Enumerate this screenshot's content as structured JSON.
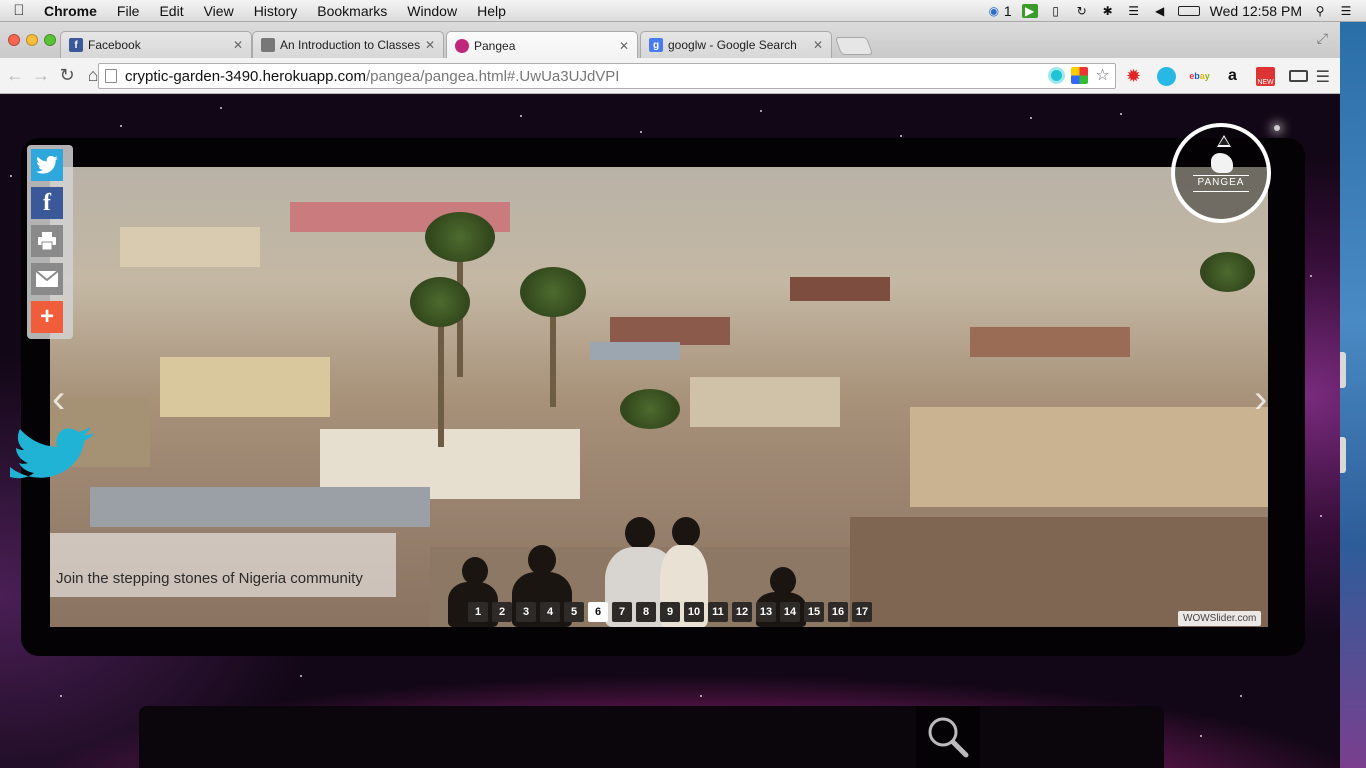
{
  "menubar": {
    "app_name": "Chrome",
    "items": [
      "File",
      "Edit",
      "View",
      "History",
      "Bookmarks",
      "Window",
      "Help"
    ],
    "status_badge": "1",
    "clock": "Wed 12:58 PM"
  },
  "tabs": [
    {
      "title": "Facebook",
      "favicon": "f",
      "favicon_color": "#3b5998",
      "active": false
    },
    {
      "title": "An Introduction to Classes",
      "favicon": "",
      "favicon_color": "#777777",
      "active": false
    },
    {
      "title": "Pangea",
      "favicon": "",
      "favicon_color": "#c0267a",
      "active": true
    },
    {
      "title": "googlw - Google Search",
      "favicon": "g",
      "favicon_color": "#4a7cf0",
      "active": false
    }
  ],
  "toolbar": {
    "url_host": "cryptic-garden-3490.herokuapp.com",
    "url_path": "/pangea/pangea.html#.UwUa3UJdVPI"
  },
  "share": {
    "buttons": [
      "twitter-icon",
      "facebook-icon",
      "print-icon",
      "email-icon",
      "add-icon"
    ]
  },
  "slider": {
    "caption": "Join the stepping stones of Nigeria community",
    "pages": [
      "1",
      "2",
      "3",
      "4",
      "5",
      "6",
      "7",
      "8",
      "9",
      "10",
      "11",
      "12",
      "13",
      "14",
      "15",
      "16",
      "17"
    ],
    "active_page": "6",
    "watermark": "WOWSlider.com"
  },
  "logo": {
    "word": "PANGEA"
  },
  "colors": {
    "accent_twitter": "#2ea7dc",
    "accent_facebook": "#3b5998",
    "accent_more": "#f05d3b"
  }
}
